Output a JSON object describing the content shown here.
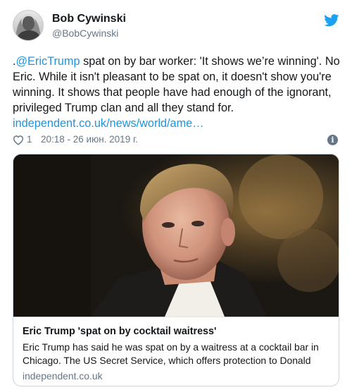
{
  "tweet": {
    "author": {
      "display_name": "Bob Cywinski",
      "handle": "@BobCywinski"
    },
    "text": {
      "prefix": ".",
      "mention": "@EricTrump",
      "body": "  spat on by bar worker: 'It shows we’re winning'. No Eric. While it isn't pleasant to be spat on, it doesn't show you're winning. It shows that people have had enough of the ignorant, privileged Trump clan and all they stand for.",
      "link": "independent.co.uk/news/world/ame…"
    },
    "meta": {
      "like_count": "1",
      "timestamp": "20:18 - 26 июн. 2019 г."
    },
    "card": {
      "title": "Eric Trump 'spat on by cocktail waitress'",
      "description": "Eric Trump has said he was spat on by a waitress at a cocktail bar in Chicago.  The US Secret Service, which offers protection to Donald",
      "domain": "independent.co.uk"
    }
  },
  "colors": {
    "twitter_blue": "#1da1f2",
    "link_blue": "#1b95e0",
    "secondary_text": "#657786",
    "border": "#ccd6dd"
  },
  "icons": {
    "brand": "twitter-bird-icon",
    "like": "heart-icon",
    "info": "info-icon"
  }
}
